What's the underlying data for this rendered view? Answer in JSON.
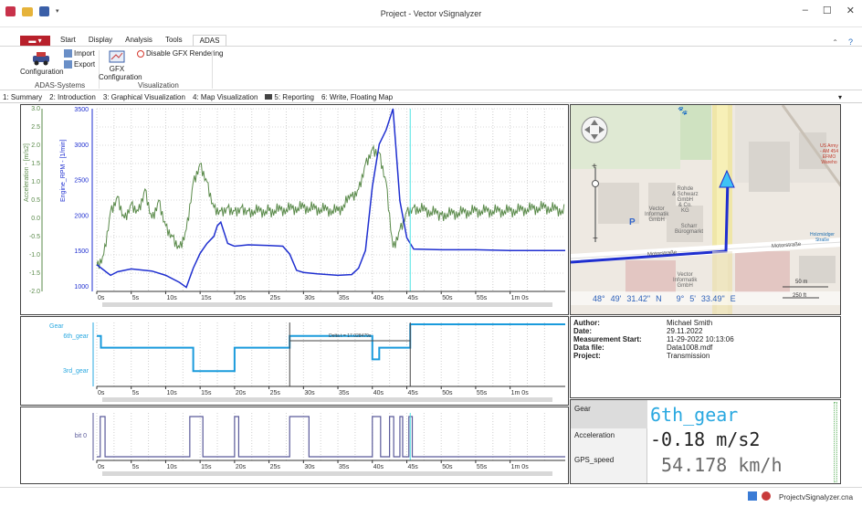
{
  "window": {
    "title": "Project - Vector vSignalyzer",
    "controls": [
      "–",
      "☐",
      "✕"
    ]
  },
  "ribbon": {
    "file_label": "▬ ▾",
    "tabs": [
      "Start",
      "Display",
      "Analysis",
      "Tools",
      "ADAS"
    ],
    "configuration_label": "Configuration",
    "import_label": "Import",
    "export_label": "Export",
    "gfx_label_1": "GFX",
    "gfx_label_2": "Configuration",
    "disable_gfx_label": "Disable GFX Rendering",
    "group_adas": "ADAS-Systems",
    "group_vis": "Visualization",
    "help": "?"
  },
  "view_tabs": [
    "1: Summary",
    "2: Introduction",
    "3: Graphical Visualization",
    "4: Map Visualization",
    "5: Reporting",
    "6: Write, Floating Map"
  ],
  "top_chart": {
    "accel_axis_label": "Acceleration - [m/s2]",
    "rpm_axis_label": "Engine_RPM - [1/min]",
    "accel_ticks": [
      "3.0",
      "2.5",
      "2.0",
      "1.5",
      "1.0",
      "0.5",
      "0.0",
      "-0.5",
      "-1.0",
      "-1.5",
      "-2.0"
    ],
    "rpm_ticks": [
      "3500",
      "3000",
      "2500",
      "2000",
      "1500",
      "1000"
    ]
  },
  "time_ticks": [
    "0s",
    "5s",
    "10s",
    "15s",
    "20s",
    "25s",
    "30s",
    "35s",
    "40s",
    "45s",
    "50s",
    "55s",
    "1m 0s"
  ],
  "gear_chart": {
    "axis_label": "Gear",
    "ticks": [
      "6th_gear",
      "3rd_gear"
    ],
    "delta_label": "Delta t = 17.028479s"
  },
  "bit_chart": {
    "tick": "bit 0"
  },
  "chart_data": [
    {
      "type": "line",
      "series": [
        {
          "name": "Engine_RPM",
          "color": "#1f2fd0",
          "x": [
            0,
            2,
            3,
            5,
            8,
            10,
            12,
            13,
            14,
            15,
            16,
            17,
            17.5,
            18,
            19,
            20,
            22,
            25,
            27,
            28,
            29,
            30,
            32,
            35,
            37,
            38,
            39,
            40,
            41,
            42,
            43,
            44,
            45,
            46,
            50,
            55,
            60,
            65,
            68
          ],
          "values": [
            1300,
            1150,
            1200,
            1240,
            1210,
            1150,
            1050,
            980,
            1250,
            1460,
            1600,
            1700,
            1850,
            1900,
            1600,
            1560,
            1580,
            1570,
            1560,
            1450,
            1220,
            1190,
            1170,
            1150,
            1160,
            1250,
            1500,
            2400,
            3000,
            3200,
            3500,
            2200,
            1680,
            1520,
            1510,
            1510,
            1500,
            1500,
            1500
          ]
        },
        {
          "name": "Acceleration",
          "color": "#5a8a4a",
          "x": [
            0,
            1,
            2,
            3,
            4,
            5,
            6,
            7,
            8,
            9,
            10,
            11,
            12,
            13,
            14,
            15,
            16,
            17,
            18,
            19,
            20,
            21,
            22,
            25,
            30,
            35,
            37,
            38,
            39,
            40,
            41,
            42,
            43,
            44,
            45,
            46,
            50,
            55,
            60,
            65,
            68
          ],
          "values": [
            -1.3,
            -1.0,
            0.2,
            0.6,
            0.0,
            0.4,
            0.2,
            0.8,
            0.0,
            0.5,
            -0.2,
            -0.5,
            -0.8,
            -0.3,
            1.0,
            1.5,
            1.0,
            0.3,
            0.2,
            0.3,
            0.2,
            0.3,
            0.2,
            0.2,
            0.3,
            0.2,
            0.6,
            0.8,
            1.5,
            1.9,
            1.8,
            1.0,
            -0.8,
            -0.3,
            0.2,
            0.3,
            0.1,
            0.2,
            0.2,
            0.3,
            0.2
          ]
        }
      ],
      "xlim": [
        0,
        68
      ],
      "ylim_rpm": [
        1000,
        3500
      ],
      "ylim_accel": [
        -2,
        3
      ]
    },
    {
      "type": "line",
      "series": [
        {
          "name": "Gear",
          "color": "#1a9bdc",
          "x": [
            0,
            0.6,
            0.6,
            14,
            14,
            20,
            20,
            28,
            28,
            40,
            40,
            41,
            41,
            45.5,
            45.5,
            68
          ],
          "values": [
            6,
            6,
            5,
            5,
            3,
            3,
            5,
            5,
            6,
            6,
            4,
            4,
            5,
            5,
            7,
            7
          ]
        }
      ],
      "xlim": [
        0,
        68
      ]
    },
    {
      "type": "line",
      "series": [
        {
          "name": "bit 0",
          "color": "#5a5a9a",
          "x": [
            0,
            0.5,
            0.5,
            1.2,
            1.2,
            13.5,
            13.5,
            15.4,
            15.4,
            20,
            20,
            20.6,
            20.6,
            28,
            28,
            30.8,
            30.8,
            40,
            40,
            41.2,
            41.2,
            42.5,
            42.5,
            43.1,
            43.1,
            44,
            44,
            44.4,
            44.4,
            45.3,
            45.3,
            45.8,
            45.8,
            68
          ],
          "values": [
            0,
            0,
            1,
            1,
            0,
            0,
            1,
            1,
            0,
            0,
            1,
            1,
            0,
            0,
            1,
            1,
            0,
            0,
            1,
            1,
            0,
            0,
            1,
            1,
            0,
            0,
            1,
            1,
            0,
            0,
            1,
            1,
            0,
            0
          ]
        }
      ],
      "xlim": [
        0,
        68
      ]
    }
  ],
  "map": {
    "coords": [
      "48°",
      "49'",
      "31.42\"",
      "N",
      "9°",
      "5'",
      "33.49\"",
      "E"
    ],
    "scale_m": "50 m",
    "scale_ft": "250 ft",
    "labels": [
      "Rohde",
      "& Schwarz",
      "GmbH",
      "& Co.",
      "KG",
      "Vector",
      "Informatik",
      "GmbH",
      "Scharr",
      "Bürogmarkt",
      "Motorstraße",
      "Motorstraße",
      "Vector",
      "Informatik",
      "GmbH",
      "US Army",
      "- AM 454",
      "EFMO Wareho",
      "Holzmädger",
      "Straße",
      "P"
    ]
  },
  "info": [
    {
      "k": "Author:",
      "v": "Michael Smith"
    },
    {
      "k": "Date:",
      "v": "29.11.2022"
    },
    {
      "k": "Measurement Start:",
      "v": "11-29-2022 10:13:06"
    },
    {
      "k": "Data file:",
      "v": "Data1008.mdf"
    },
    {
      "k": "Project:",
      "v": "Transmission"
    }
  ],
  "signals": [
    {
      "name": "Gear",
      "value": "6th_gear",
      "color": "#29a8e0"
    },
    {
      "name": "Acceleration",
      "value": "-0.18 m/s2",
      "color": "#222222"
    },
    {
      "name": "GPS_speed",
      "value": " 54.178 km/h",
      "color": "#6b6b6b"
    }
  ],
  "status": {
    "project": "Project",
    "file": "vSignalyzer.cna"
  }
}
